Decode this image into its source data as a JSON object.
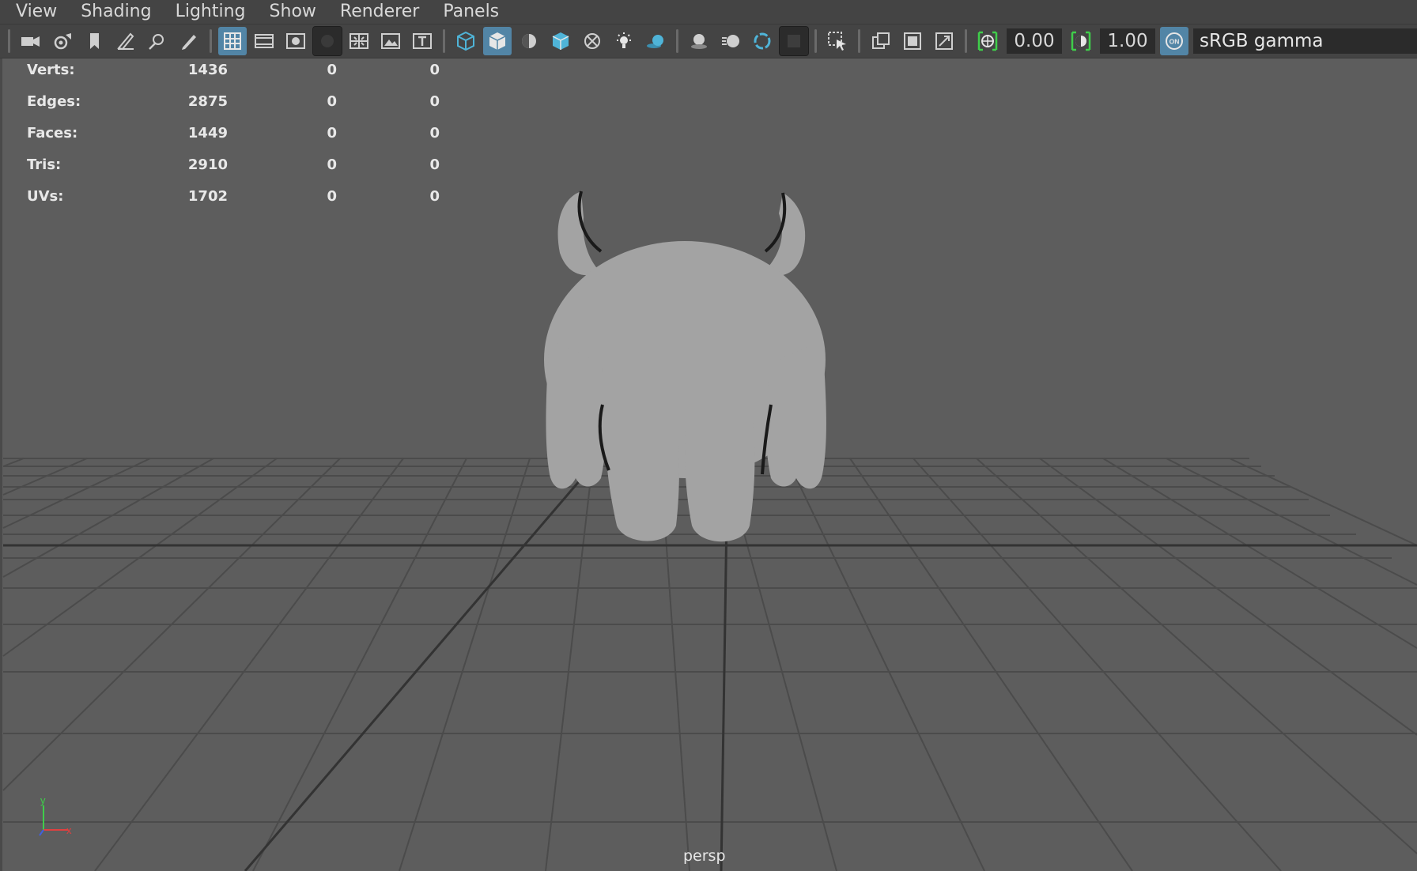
{
  "menu": [
    "View",
    "Shading",
    "Lighting",
    "Show",
    "Renderer",
    "Panels"
  ],
  "toolbar": {
    "exposure_value": "0.00",
    "gamma_value": "1.00",
    "color_management_badge": "ON",
    "view_transform": "sRGB gamma"
  },
  "hud": {
    "rows": [
      {
        "label": "Verts:",
        "values": [
          "1436",
          "0",
          "0"
        ]
      },
      {
        "label": "Edges:",
        "values": [
          "2875",
          "0",
          "0"
        ]
      },
      {
        "label": "Faces:",
        "values": [
          "1449",
          "0",
          "0"
        ]
      },
      {
        "label": "Tris:",
        "values": [
          "2910",
          "0",
          "0"
        ]
      },
      {
        "label": "UVs:",
        "values": [
          "1702",
          "0",
          "0"
        ]
      }
    ]
  },
  "viewport": {
    "camera": "persp",
    "axis": {
      "y": "y",
      "x": "x"
    }
  },
  "colors": {
    "background": "#5d5d5d",
    "toolbar": "#444444",
    "active_button": "#5285a6",
    "grid": "#4c4c4c",
    "model": "#a3a3a3"
  }
}
